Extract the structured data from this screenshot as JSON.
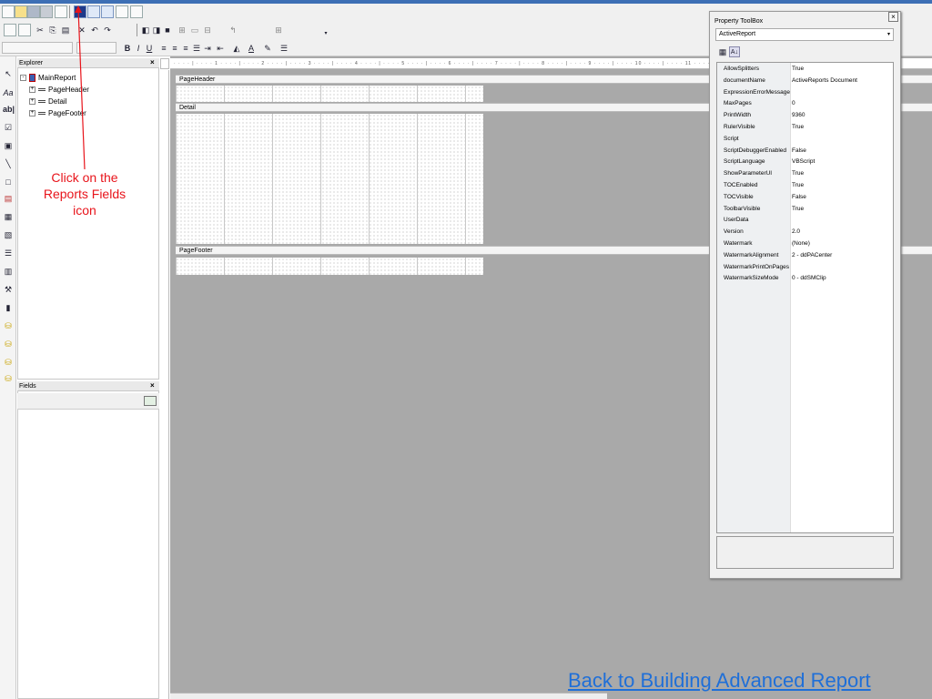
{
  "explorer": {
    "title": "Explorer",
    "tree": [
      {
        "label": "MainReport"
      },
      {
        "label": "PageHeader"
      },
      {
        "label": "Detail"
      },
      {
        "label": "PageFooter"
      }
    ]
  },
  "fields": {
    "title": "Fields"
  },
  "annotation": {
    "text": "Click on the Reports Fields icon"
  },
  "designer": {
    "bands": [
      "PageHeader",
      "Detail",
      "PageFooter"
    ],
    "ruler_numbers": [
      "1",
      "2",
      "3",
      "4",
      "5",
      "6",
      "7",
      "8",
      "9",
      "10",
      "11"
    ]
  },
  "property_toolbox": {
    "title": "Property ToolBox",
    "object": "ActiveReport",
    "properties": [
      {
        "name": "AllowSplitters",
        "value": "True"
      },
      {
        "name": "documentName",
        "value": "ActiveReports Document"
      },
      {
        "name": "ExpressionErrorMessage",
        "value": ""
      },
      {
        "name": "MaxPages",
        "value": "0"
      },
      {
        "name": "PrintWidth",
        "value": "9360"
      },
      {
        "name": "RulerVisible",
        "value": "True"
      },
      {
        "name": "Script",
        "value": ""
      },
      {
        "name": "ScriptDebuggerEnabled",
        "value": "False"
      },
      {
        "name": "ScriptLanguage",
        "value": "VBScript"
      },
      {
        "name": "ShowParameterUI",
        "value": "True"
      },
      {
        "name": "TOCEnabled",
        "value": "True"
      },
      {
        "name": "TOCVisible",
        "value": "False"
      },
      {
        "name": "ToolbarVisible",
        "value": "True"
      },
      {
        "name": "UserData",
        "value": ""
      },
      {
        "name": "Version",
        "value": "2.0"
      },
      {
        "name": "Watermark",
        "value": "(None)"
      },
      {
        "name": "WatermarkAlignment",
        "value": "2 - ddPACenter"
      },
      {
        "name": "WatermarkPrintOnPages",
        "value": ""
      },
      {
        "name": "WatermarkSizeMode",
        "value": "0 - ddSMClip"
      }
    ]
  },
  "link": {
    "text": "Back to Building Advanced Report"
  },
  "colors": {
    "annotation_red": "#e8141b",
    "link_blue": "#1f6fd8",
    "canvas_gray": "#a9a9a9"
  }
}
